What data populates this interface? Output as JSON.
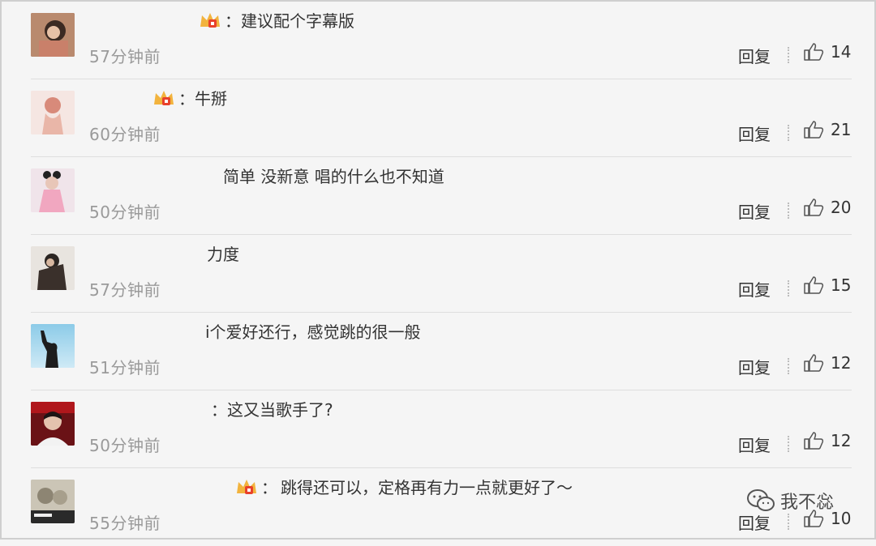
{
  "comments": [
    {
      "text": "建议配个字幕版",
      "time": "57分钟前",
      "likes": "14",
      "reply_label": "回复",
      "badge": "crown-badge-icon",
      "text_prefix": "："
    },
    {
      "text": "牛掰",
      "time": "60分钟前",
      "likes": "21",
      "reply_label": "回复",
      "badge": "crown-badge-icon",
      "text_prefix": "："
    },
    {
      "text": "简单 没新意 唱的什么也不知道",
      "time": "50分钟前",
      "likes": "20",
      "reply_label": "回复"
    },
    {
      "text": "力度",
      "time": "57分钟前",
      "likes": "15",
      "reply_label": "回复"
    },
    {
      "text": "i个爱好还行，感觉跳的很一般",
      "time": "51分钟前",
      "likes": "12",
      "reply_label": "回复"
    },
    {
      "text": "：这又当歌手了?",
      "time": "50分钟前",
      "likes": "12",
      "reply_label": "回复"
    },
    {
      "text": "跳得还可以，定格再有力一点就更好了～",
      "time": "55分钟前",
      "likes": "10",
      "reply_label": "回复",
      "badge": "crown-badge-icon"
    }
  ],
  "watermark": {
    "text": "我不惢",
    "icon": "wechat-icon"
  },
  "colors": {
    "time_text": "#9a9a9a",
    "divider": "#dedede",
    "badge_red": "#e8412b",
    "badge_gold": "#f2b33d"
  }
}
